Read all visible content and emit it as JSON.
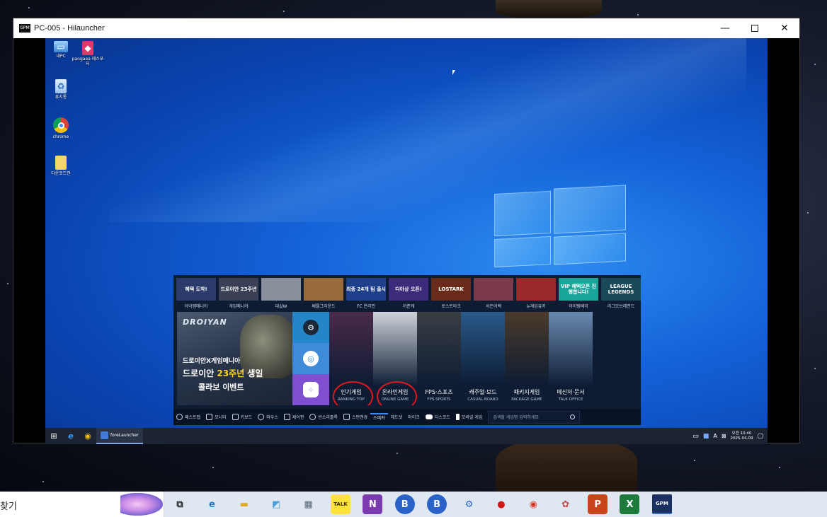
{
  "window": {
    "title": "PC-005 - Hilauncher",
    "app_icon_text": "GPM"
  },
  "remote_desktop": {
    "icons": [
      {
        "name": "this-pc-icon",
        "label": "내PC"
      },
      {
        "name": "pangaea-icon",
        "label": "pangaea 패스포터"
      },
      {
        "name": "recycle-bin-icon",
        "label": "휴지통"
      },
      {
        "name": "chrome-icon",
        "label": "chrome"
      },
      {
        "name": "folder-icon",
        "label": "다운로드안"
      }
    ]
  },
  "launcher": {
    "top_games": [
      {
        "thumb": "혜택 도착!",
        "caption": "아이템매니아",
        "color": "#2a3a6a"
      },
      {
        "thumb": "드로이안 23주년",
        "caption": "게임매니아",
        "color": "#3a3f55"
      },
      {
        "thumb": "",
        "caption": "대실W",
        "color": "#8a8f9c"
      },
      {
        "thumb": "",
        "caption": "배틀그라운드",
        "color": "#9a6b3a"
      },
      {
        "thumb": "최종 24개 팀 출시",
        "caption": "FC 온라인",
        "color": "#1e3f8c"
      },
      {
        "thumb": "디아상 오픈!",
        "caption": "저준케",
        "color": "#3c2a7a"
      },
      {
        "thumb": "LOSTARK",
        "caption": "로스트아크",
        "color": "#6a2a1a"
      },
      {
        "thumb": "",
        "caption": "서든어택",
        "color": "#7a3a4a"
      },
      {
        "thumb": "",
        "caption": "뉴게임유키",
        "color": "#9a2a2a"
      },
      {
        "thumb": "VIP 혜택오픈 진행합니다!",
        "caption": "아이템베이",
        "color": "#1aa59a"
      },
      {
        "thumb": "LEAGUE LEGENDS",
        "caption": "리그오브레전드",
        "color": "#1a4a5a"
      }
    ],
    "banner": {
      "logo": "DROIYAN",
      "line1": "드로이안X게임매니아",
      "line2_a": "드로이안",
      "line2_b": "23주년",
      "line2_c": "생일",
      "line3": "콜라보 이벤트"
    },
    "quick_buttons": [
      "steam-icon",
      "chrome-icon",
      "apps-icon"
    ],
    "categories": [
      {
        "title": "인기게임",
        "sub": "RANKING TOP",
        "circled": true,
        "color": "#4a2a4a"
      },
      {
        "title": "온라인게임",
        "sub": "ONLINE GAME",
        "circled": true,
        "color": "#cfd3da"
      },
      {
        "title": "FPS·스포츠",
        "sub": "FPS·SPORTS",
        "circled": false,
        "color": "#3a3e44"
      },
      {
        "title": "캐주얼·보드",
        "sub": "CASUAL·BOARD",
        "circled": false,
        "color": "#2a5a8a"
      },
      {
        "title": "패키지게임",
        "sub": "PACKAGE GAME",
        "circled": false,
        "color": "#4a3a2a"
      },
      {
        "title": "메신저·문서",
        "sub": "TALK·OFFICE",
        "circled": false,
        "color": "#6a8ab0"
      }
    ],
    "bottom_bar": {
      "items": [
        "패스트캡",
        "모니터",
        "키보드",
        "마우스",
        "제어판",
        "반소리줄록",
        "스펀엔경"
      ],
      "tabs": [
        "스피커",
        "헤드셋",
        "마이크"
      ],
      "discord": "디스코드",
      "mobile": "모바일 게임",
      "search_placeholder": "검색할 게임명 입력하세요"
    }
  },
  "remote_taskbar": {
    "app_label": "foreLauncher",
    "clock_time": "오전 10:40",
    "clock_date": "2025-04-09",
    "lang": "A"
  },
  "host_taskbar": {
    "search_text": "찾기",
    "apps": [
      {
        "name": "task-view-icon",
        "glyph": "⧉",
        "color": "#222222"
      },
      {
        "name": "edge-icon",
        "glyph": "e",
        "color": "#1e7bd6"
      },
      {
        "name": "file-explorer-icon",
        "glyph": "▬",
        "color": "#e0a92a"
      },
      {
        "name": "notes-icon",
        "glyph": "◩",
        "color": "#4aa0d8"
      },
      {
        "name": "calculator-icon",
        "glyph": "▦",
        "color": "#5a6a7a"
      },
      {
        "name": "kakaotalk-icon",
        "glyph": "TALK",
        "color": "#3a2a00"
      },
      {
        "name": "onenote-icon",
        "glyph": "N",
        "color": "#7a3ab0"
      },
      {
        "name": "app-b1-icon",
        "glyph": "B",
        "color": "#2a62c8"
      },
      {
        "name": "app-b2-icon",
        "glyph": "B",
        "color": "#2a62c8"
      },
      {
        "name": "settings-icon",
        "glyph": "⚙",
        "color": "#2a62c8"
      },
      {
        "name": "record-icon",
        "glyph": "●",
        "color": "#d01818"
      },
      {
        "name": "chrome-icon",
        "glyph": "◉",
        "color": "#d93a2a"
      },
      {
        "name": "pinwheel-icon",
        "glyph": "✿",
        "color": "#c04a4a"
      },
      {
        "name": "powerpoint-icon",
        "glyph": "P",
        "color": "#c8451c"
      },
      {
        "name": "excel-icon",
        "glyph": "X",
        "color": "#1e7a3a"
      },
      {
        "name": "gpm-icon",
        "glyph": "GPM",
        "color": "#ffffff"
      }
    ]
  }
}
